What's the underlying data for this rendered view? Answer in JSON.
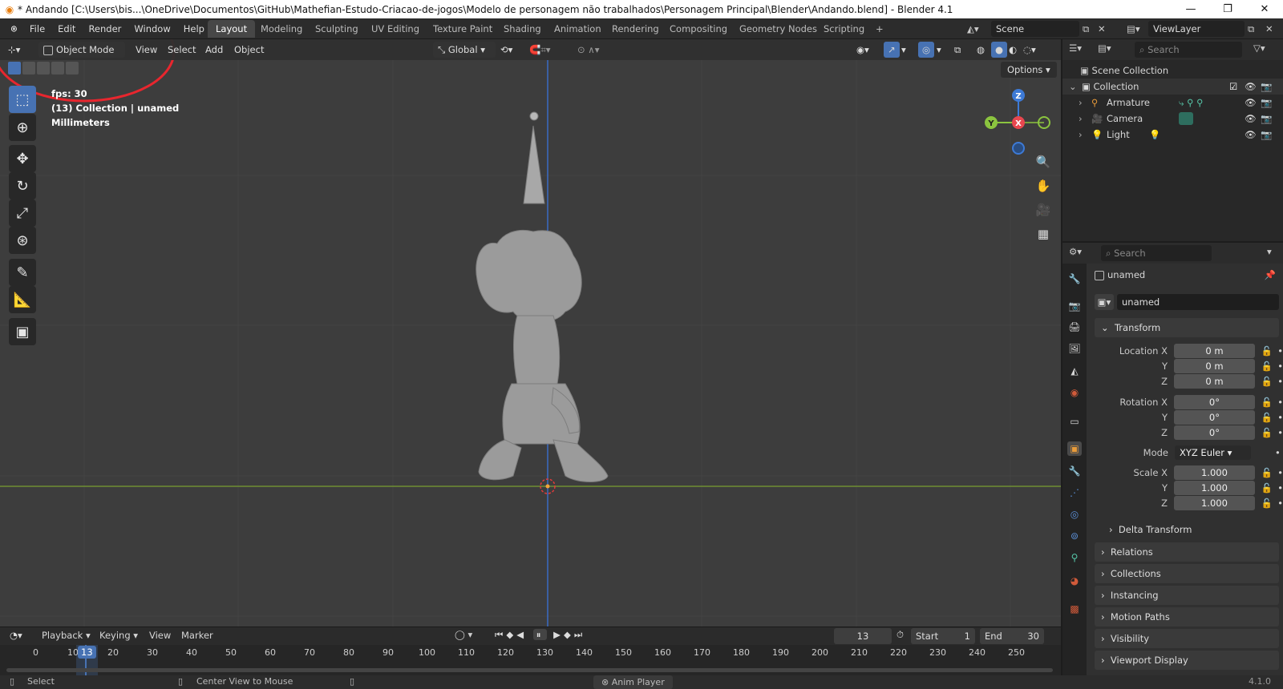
{
  "window": {
    "title": "* Andando [C:\\Users\\bis...\\OneDrive\\Documentos\\GitHub\\Mathefian-Estudo-Criacao-de-jogos\\Modelo de personagem não trabalhados\\Personagem Principal\\Blender\\Andando.blend] - Blender 4.1",
    "controls": [
      "—",
      "❐",
      "✕"
    ]
  },
  "menubar": {
    "items": [
      "File",
      "Edit",
      "Render",
      "Window",
      "Help"
    ]
  },
  "workspaces": {
    "tabs": [
      "Layout",
      "Modeling",
      "Sculpting",
      "UV Editing",
      "Texture Paint",
      "Shading",
      "Animation",
      "Rendering",
      "Compositing",
      "Geometry Nodes",
      "Scripting"
    ],
    "active": "Layout",
    "add": "+"
  },
  "scene": {
    "label": "Scene"
  },
  "viewlayer": {
    "label": "ViewLayer"
  },
  "viewport_header": {
    "mode": "Object Mode",
    "menus": [
      "View",
      "Select",
      "Add",
      "Object"
    ],
    "orientation": "Global",
    "options": "Options"
  },
  "overlay_text": {
    "fps": "fps: 30",
    "collection": "(13) Collection | unamed",
    "units": "Millimeters"
  },
  "gizmo": {
    "z": "Z",
    "y": "Y",
    "x": "X"
  },
  "outliner": {
    "search_placeholder": "Search",
    "root": "Scene Collection",
    "collection": "Collection",
    "items": [
      "Armature",
      "Camera",
      "Light"
    ]
  },
  "properties": {
    "search_placeholder": "Search",
    "object_name": "unamed",
    "data_name": "unamed",
    "transform_header": "Transform",
    "location_label": "Location X",
    "rotation_label": "Rotation X",
    "scale_label": "Scale X",
    "y_label": "Y",
    "z_label": "Z",
    "mode_label": "Mode",
    "location": [
      "0 m",
      "0 m",
      "0 m"
    ],
    "rotation": [
      "0°",
      "0°",
      "0°"
    ],
    "rotation_mode": "XYZ Euler",
    "scale": [
      "1.000",
      "1.000",
      "1.000"
    ],
    "delta_transform": "Delta Transform",
    "panels": [
      "Relations",
      "Collections",
      "Instancing",
      "Motion Paths",
      "Visibility",
      "Viewport Display"
    ]
  },
  "timeline": {
    "menus": [
      "Playback",
      "Keying",
      "View",
      "Marker"
    ],
    "current_frame": "13",
    "start_label": "Start",
    "start_value": "1",
    "end_label": "End",
    "end_value": "30",
    "ruler": [
      "0",
      "10",
      "20",
      "30",
      "40",
      "50",
      "60",
      "70",
      "80",
      "90",
      "100",
      "110",
      "120",
      "130",
      "140",
      "150",
      "160",
      "170",
      "180",
      "190",
      "200",
      "210",
      "220",
      "230",
      "240",
      "250"
    ],
    "cursor_label": "13"
  },
  "statusbar": {
    "select": "Select",
    "center": "Center View to Mouse",
    "anim": "Anim Player",
    "version": "4.1.0"
  },
  "colors": {
    "accent": "#4772b3",
    "annotation": "#e8262e",
    "x_axis": "#e8474f",
    "y_axis": "#8bc43f",
    "z_axis": "#3d7ad6"
  }
}
